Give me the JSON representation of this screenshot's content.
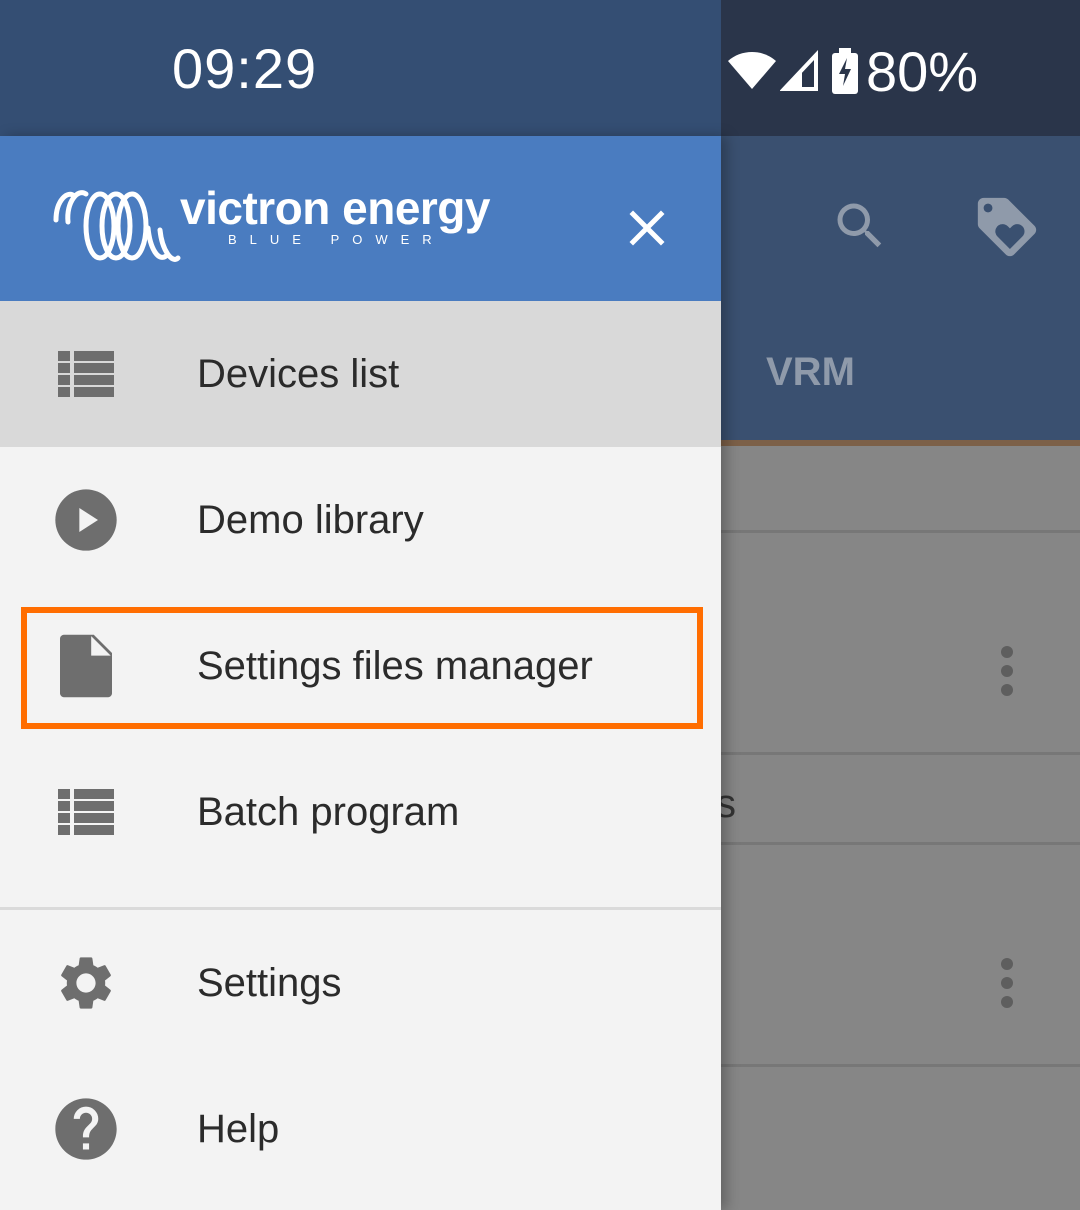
{
  "status_bar": {
    "time": "09:29",
    "battery": "80%",
    "icons": [
      "wifi-icon",
      "cell-signal-icon",
      "battery-charging-icon"
    ]
  },
  "drawer": {
    "header": {
      "brand_name": "victron energy",
      "brand_tagline": "BLUE POWER",
      "close_icon": "close-icon"
    },
    "items": [
      {
        "label": "Devices list",
        "icon": "list-icon",
        "active": true
      },
      {
        "label": "Demo library",
        "icon": "play-circle-icon",
        "active": false
      },
      {
        "label": "Settings files manager",
        "icon": "file-icon",
        "active": false,
        "highlighted": true
      },
      {
        "label": "Batch program",
        "icon": "list-icon",
        "active": false
      },
      {
        "label": "Settings",
        "icon": "gear-icon",
        "active": false
      },
      {
        "label": "Help",
        "icon": "help-circle-icon",
        "active": false
      }
    ]
  },
  "background_app": {
    "toolbar_icons": [
      "search-icon",
      "tag-heart-icon"
    ],
    "tab_label": "VRM",
    "partial_text": "s"
  },
  "colors": {
    "drawer_header": "#4a7cc0",
    "status_bar": "#344e73",
    "highlight": "#ff6d00",
    "active_item": "#d9d9d9"
  }
}
